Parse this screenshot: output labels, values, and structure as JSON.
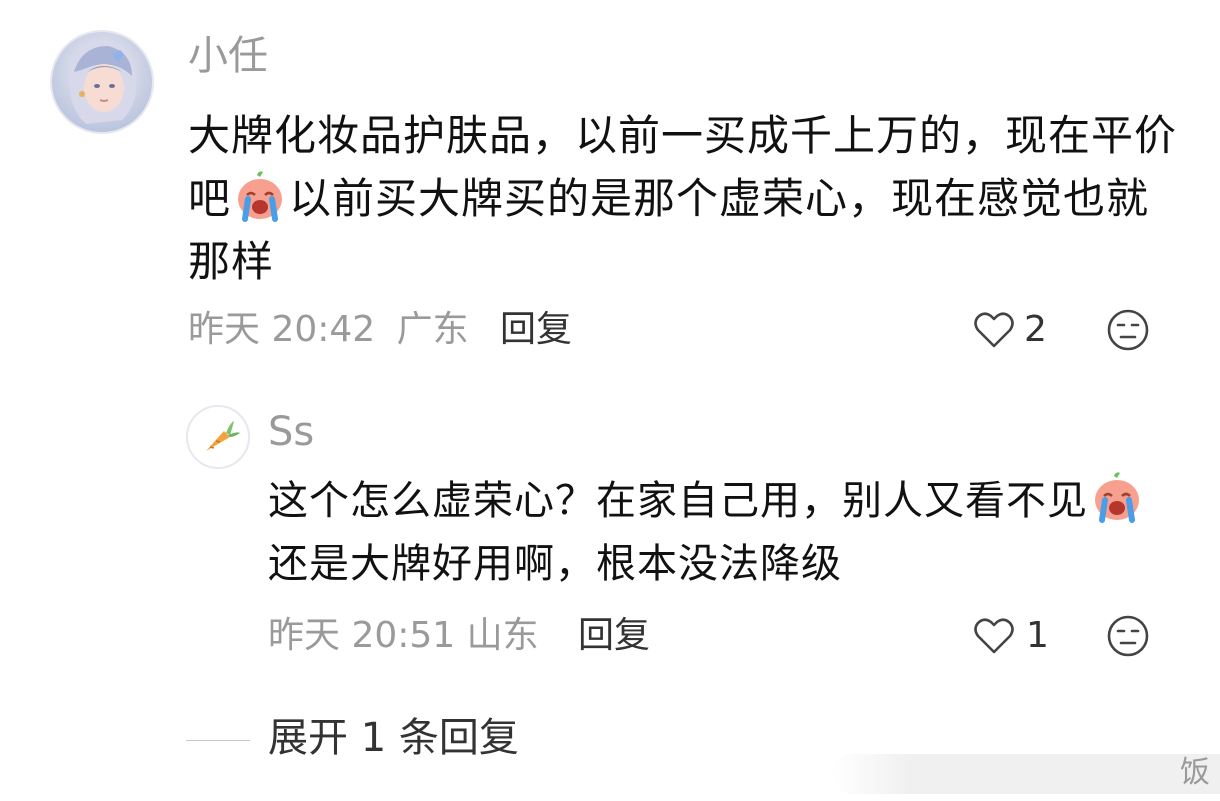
{
  "comment": {
    "username": "小任",
    "text_part1": "大牌化妆品护肤品，以前一买成千上万的，现在平价吧",
    "text_part2": "以前买大牌买的是那个虚荣心，现在感觉也就那样",
    "time": "昨天 20:42",
    "location": "广东",
    "reply_label": "回复",
    "like_count": "2"
  },
  "reply": {
    "username": "Ss",
    "text_part1": "这个怎么虚荣心？在家自己用，别人又看不见",
    "text_part2": "还是大牌好用啊，根本没法降级",
    "time": "昨天 20:51",
    "location": "山东",
    "reply_label": "回复",
    "like_count": "1"
  },
  "expand_label": "展开 1 条回复",
  "watermark_text": "饭",
  "icons": {
    "emoji": "crying-emoji-icon",
    "like": "heart-outline-icon",
    "reaction": "neutral-face-icon",
    "avatar_reply": "carrot-icon"
  },
  "colors": {
    "text_primary": "#111111",
    "text_secondary": "#9a9a9a",
    "emoji_pink": "#f59a8e"
  }
}
